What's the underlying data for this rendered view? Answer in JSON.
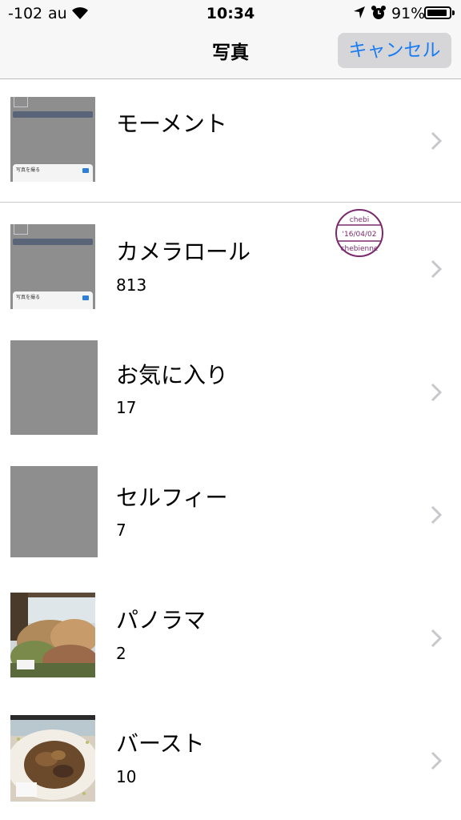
{
  "status_bar": {
    "signal": "-102",
    "carrier": "au",
    "time": "10:34",
    "battery_pct": "91%",
    "battery_level": 0.91
  },
  "nav": {
    "title": "写真",
    "cancel_label": "キャンセル"
  },
  "albums": [
    {
      "label": "モーメント",
      "count": ""
    },
    {
      "label": "カメラロール",
      "count": "813"
    },
    {
      "label": "お気に入り",
      "count": "17"
    },
    {
      "label": "セルフィー",
      "count": "7"
    },
    {
      "label": "パノラマ",
      "count": "2"
    },
    {
      "label": "バースト",
      "count": "10"
    }
  ],
  "thumb_text": {
    "take_photo": "写真を撮る"
  },
  "stamp": {
    "top": "chebi",
    "date": "'16/04/02",
    "bottom": "chebienne"
  },
  "colors": {
    "accent": "#1a7cf2",
    "stamp": "#7a2a6e"
  }
}
